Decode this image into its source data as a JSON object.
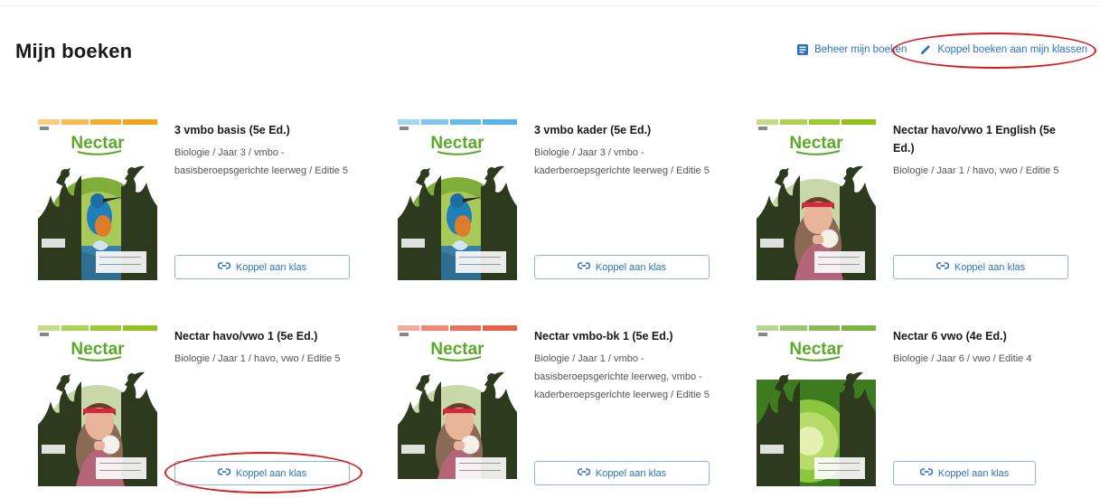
{
  "header": {
    "title": "Mijn boeken",
    "manage_label": "Beheer mijn boeken",
    "link_label": "Koppel boeken aan mijn klassen"
  },
  "books": [
    {
      "title": "3 vmbo basis (5e Ed.)",
      "description": "Biologie / Jaar 3 / vmbo - basisberoepsgerichte leerweg / Editie 5",
      "cover_brand": "Nectar",
      "cover_accent": "#f2a51c",
      "cover_image": "kingfisher",
      "button_label": "Koppel aan klas"
    },
    {
      "title": "3 vmbo kader (5e Ed.)",
      "description": "Biologie / Jaar 3 / vmbo - kaderberoepsgerichte leerweg / Editie 5",
      "cover_brand": "Nectar",
      "cover_accent": "#5ab3e6",
      "cover_image": "kingfisher",
      "button_label": "Koppel aan klas"
    },
    {
      "title": "Nectar havo/vwo 1 English (5e Ed.)",
      "description": "Biologie / Jaar 1 / havo, vwo / Editie 5",
      "cover_brand": "Nectar",
      "cover_accent": "#94c11f",
      "cover_image": "girl-dandelion",
      "button_label": "Koppel aan klas"
    },
    {
      "title": "Nectar havo/vwo 1 (5e Ed.)",
      "description": "Biologie / Jaar 1 / havo, vwo / Editie 5",
      "cover_brand": "Nectar",
      "cover_accent": "#94c11f",
      "cover_image": "girl-dandelion",
      "button_label": "Koppel aan klas"
    },
    {
      "title": "Nectar vmbo-bk 1 (5e Ed.)",
      "description": "Biologie / Jaar 1 / vmbo - basisberoepsgerichte leerweg, vmbo - kaderberoepsgerichte leerweg / Editie 5",
      "cover_brand": "Nectar",
      "cover_accent": "#e8624a",
      "cover_image": "girl-dandelion",
      "button_label": "Koppel aan klas"
    },
    {
      "title": "Nectar 6 vwo (4e Ed.)",
      "description": "Biologie / Jaar 6 / vwo / Editie 4",
      "cover_brand": "Nectar",
      "cover_accent": "#7cb342",
      "cover_image": "green-cell",
      "button_label": "Koppel aan klas"
    }
  ],
  "colors": {
    "link": "#2b73c8",
    "highlight": "#d81b1b",
    "brand_green": "#5aaa2a"
  },
  "icons": {
    "manage": "book-list-icon",
    "link_books": "pencil-icon",
    "button": "link-icon"
  }
}
